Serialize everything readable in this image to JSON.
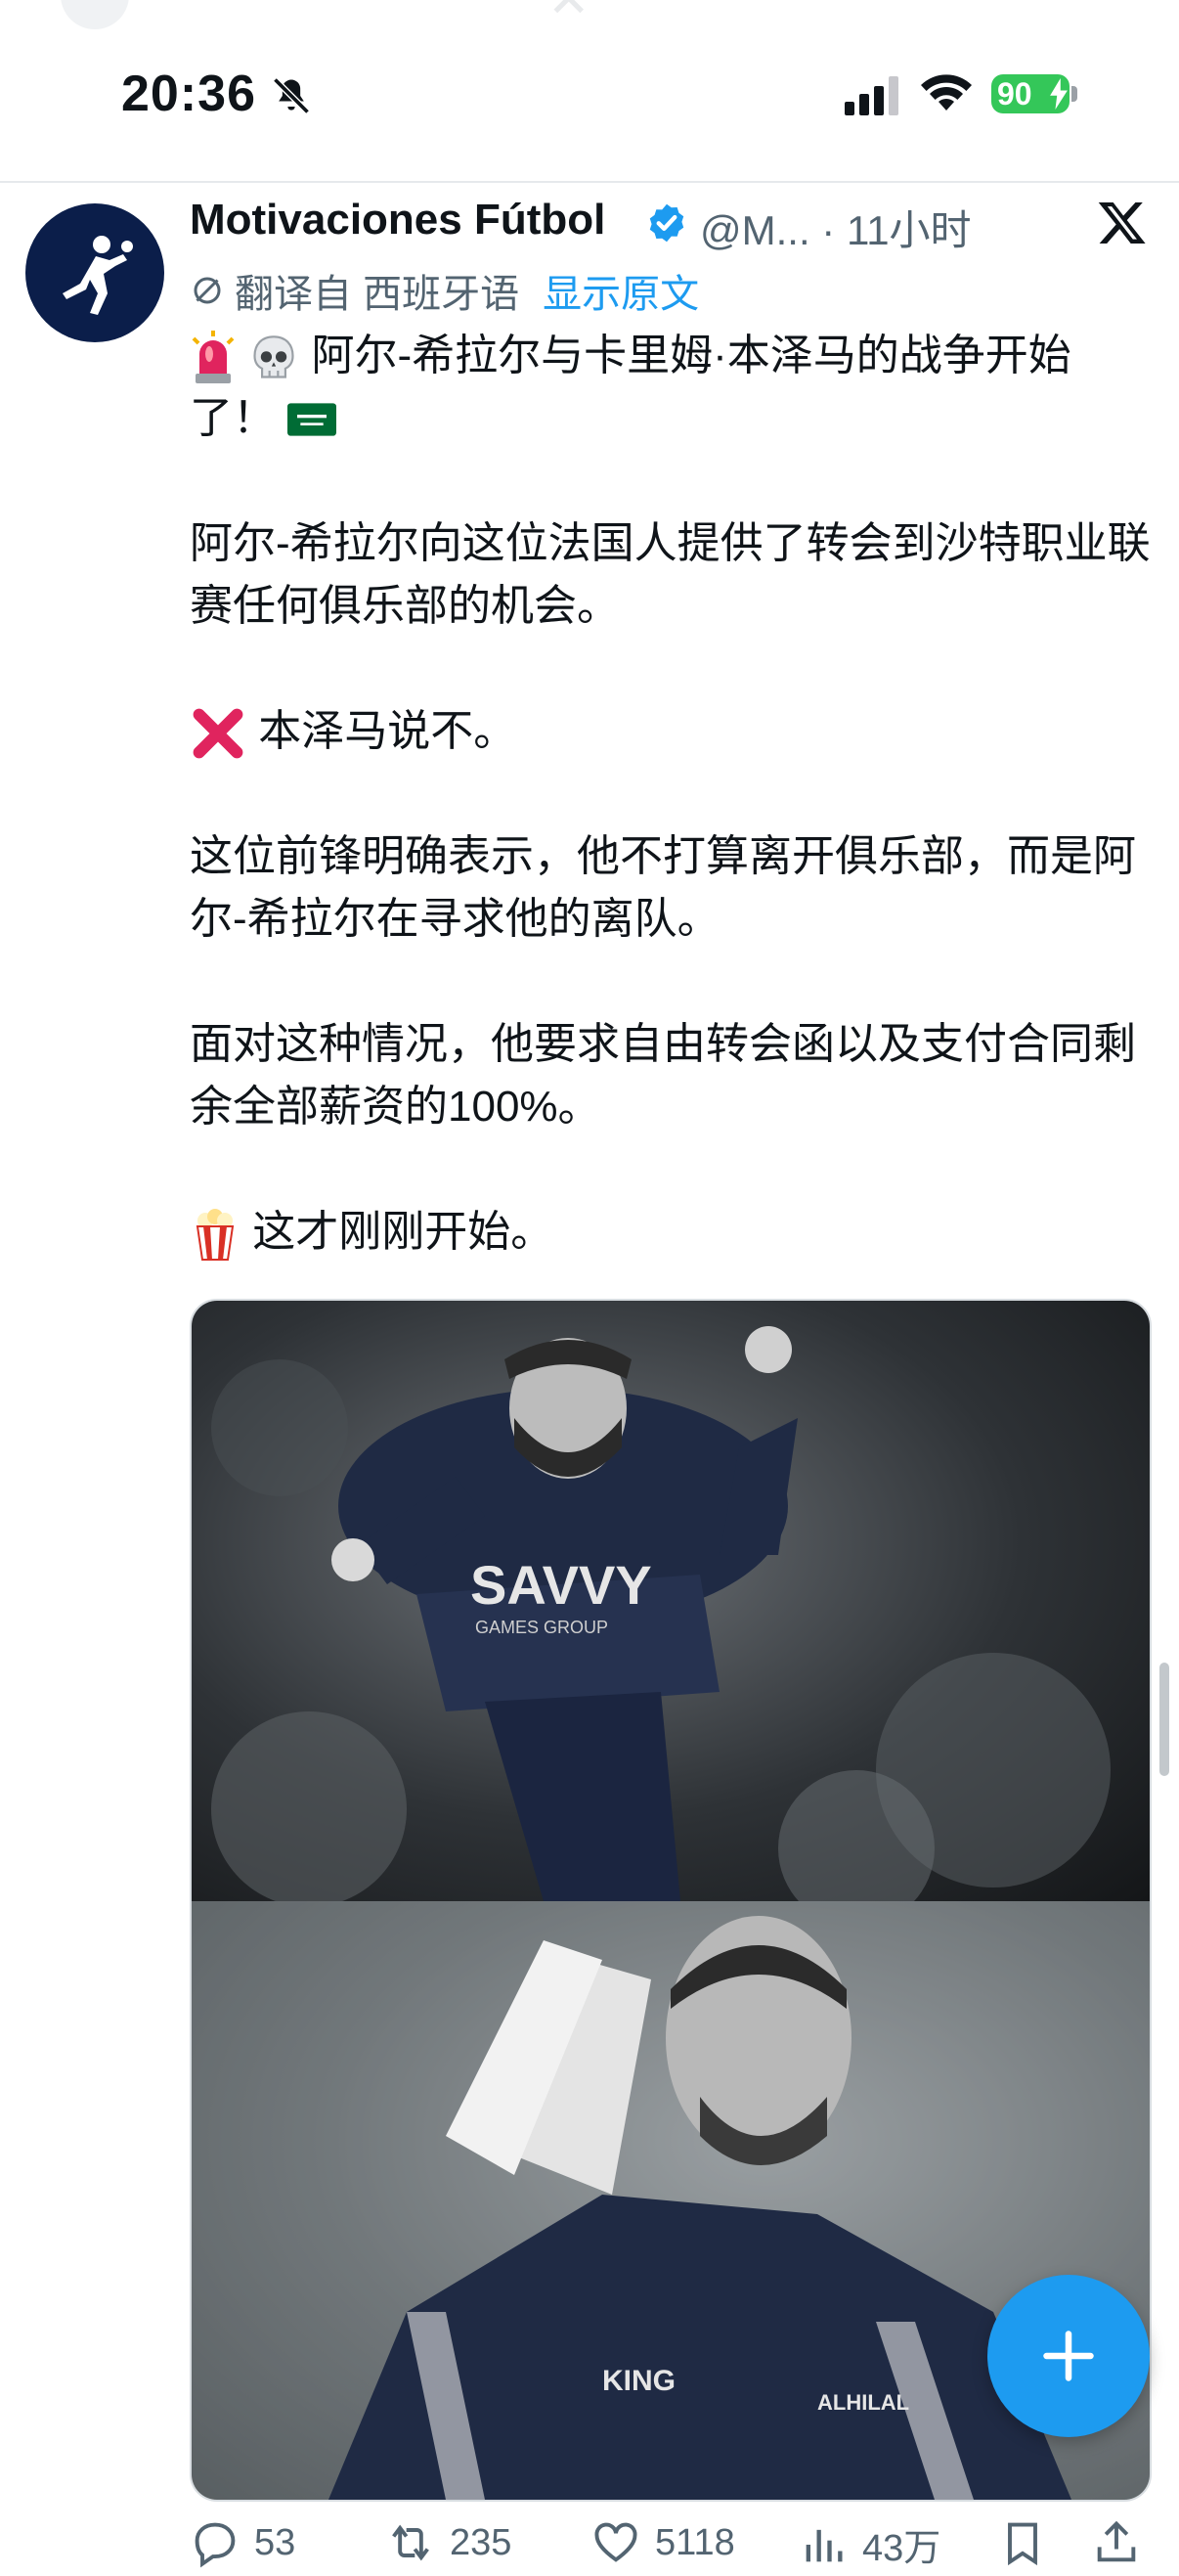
{
  "status_bar": {
    "time": "20:36",
    "battery_level": "90",
    "battery_color": "#34c759",
    "icons": [
      "bell-slash-icon",
      "signal-icon",
      "wifi-icon",
      "battery-charging-icon"
    ]
  },
  "tweet": {
    "author_name": "Motivaciones Fútbol",
    "verified": true,
    "handle_time": "@M... · 11小时",
    "translation": {
      "label": "翻译自 西班牙语",
      "show_original": "显示原文"
    },
    "paragraphs": {
      "p1": "阿尔-希拉尔与卡里姆·本泽马的战争开始了！",
      "p2": "阿尔-希拉尔向这位法国人提供了转会到沙特职业联赛任何俱乐部的机会。",
      "p3": "本泽马说不。",
      "p4": "这位前锋明确表示，他不打算离开俱乐部，而是阿尔-希拉尔在寻求他的离队。",
      "p5": "面对这种情况，他要求自由转会函以及支付合同剩余全部薪资的100%。",
      "p6": "这才刚刚开始。"
    },
    "media_count": 2,
    "stats": {
      "replies": "53",
      "retweets": "235",
      "likes": "5118",
      "views": "43万"
    }
  },
  "colors": {
    "accent": "#1d9bf0",
    "text_primary": "#0f1419",
    "text_secondary": "#536471"
  }
}
